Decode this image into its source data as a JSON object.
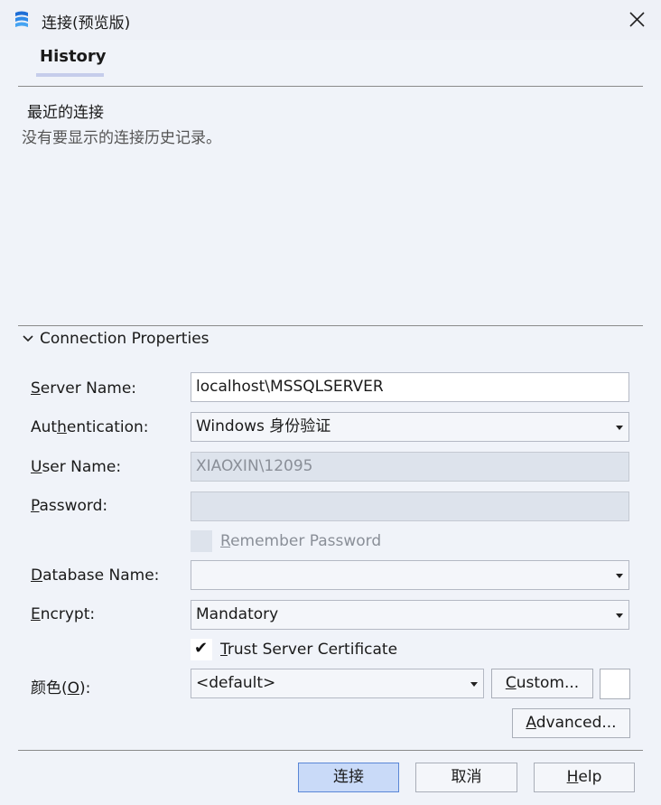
{
  "window": {
    "title": "连接(预览版)"
  },
  "tabs": [
    {
      "label": "History"
    }
  ],
  "history": {
    "title": "最近的连接",
    "empty_text": "没有要显示的连接历史记录。"
  },
  "connection": {
    "section_title": "Connection Properties",
    "server_name": {
      "label_pre": "",
      "label_key": "S",
      "label_post": "erver Name:",
      "value": "localhost\\MSSQLSERVER"
    },
    "authentication": {
      "label_pre": "Aut",
      "label_key": "h",
      "label_post": "entication:",
      "value": "Windows 身份验证"
    },
    "user_name": {
      "label_pre": "",
      "label_key": "U",
      "label_post": "ser Name:",
      "value": "XIAOXIN\\12095"
    },
    "password": {
      "label_pre": "",
      "label_key": "P",
      "label_post": "assword:",
      "value": ""
    },
    "remember_password": {
      "label_pre": "",
      "label_key": "R",
      "label_post": "emember Password",
      "checked": false,
      "enabled": false
    },
    "database_name": {
      "label_pre": "",
      "label_key": "D",
      "label_post": "atabase Name:",
      "value": ""
    },
    "encrypt": {
      "label_pre": "",
      "label_key": "E",
      "label_post": "ncrypt:",
      "value": "Mandatory"
    },
    "trust_cert": {
      "label_pre": "",
      "label_key": "T",
      "label_post": "rust Server Certificate",
      "checked": true,
      "check_glyph": "✔"
    },
    "color": {
      "label_pre": "颜色(",
      "label_key": "O",
      "label_post": "):",
      "value": "<default>"
    },
    "custom_button": {
      "pre": "",
      "key": "C",
      "post": "ustom..."
    },
    "advanced_button": {
      "pre": "",
      "key": "A",
      "post": "dvanced..."
    }
  },
  "footer": {
    "connect_label": "连接",
    "cancel_label": "取消",
    "help": {
      "pre": "",
      "key": "H",
      "post": "elp"
    }
  },
  "colors": {
    "background": "#f0f3f9",
    "primary_button": "#c9daf8",
    "disabled_field": "#dde3ec",
    "tab_underline": "#c6cdeb"
  },
  "icons": {
    "app": "azure-data-studio-icon",
    "close": "close-icon",
    "chevron": "chevron-down-icon",
    "dropdown": "dropdown-caret-icon",
    "check": "checkmark-icon"
  }
}
